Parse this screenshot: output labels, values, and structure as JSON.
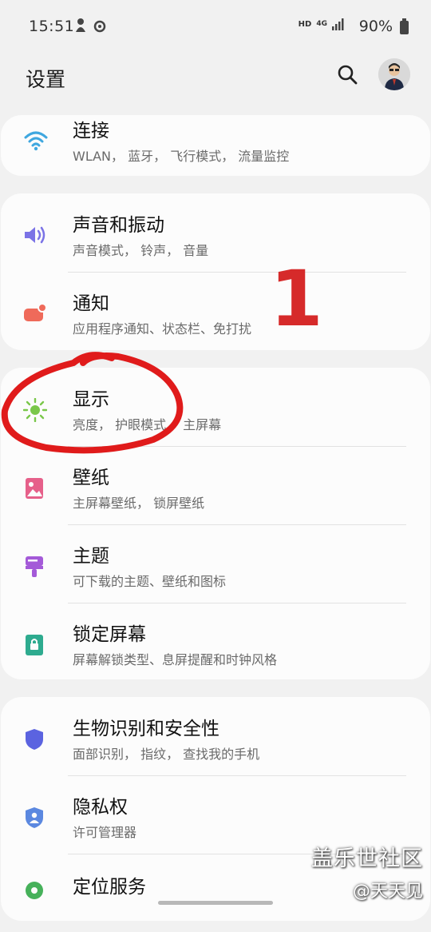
{
  "status_bar": {
    "time": "15:51",
    "hd": "HD",
    "network": "4G",
    "battery": "90%"
  },
  "header": {
    "title": "设置"
  },
  "sections": [
    {
      "items": [
        {
          "title": "连接",
          "subtitle": "WLAN， 蓝牙， 飞行模式， 流量监控",
          "icon": "wifi-icon",
          "color": "#3fa7df"
        }
      ]
    },
    {
      "items": [
        {
          "title": "声音和振动",
          "subtitle": "声音模式， 铃声， 音量",
          "icon": "volume-icon",
          "color": "#7b73e6"
        },
        {
          "title": "通知",
          "subtitle": "应用程序通知、状态栏、免打扰",
          "icon": "notification-icon",
          "color": "#ef6a5a"
        }
      ]
    },
    {
      "items": [
        {
          "title": "显示",
          "subtitle": "亮度， 护眼模式， 主屏幕",
          "icon": "brightness-icon",
          "color": "#7ac74a"
        },
        {
          "title": "壁纸",
          "subtitle": "主屏幕壁纸， 锁屏壁纸",
          "icon": "wallpaper-icon",
          "color": "#e6608a"
        },
        {
          "title": "主题",
          "subtitle": "可下载的主题、壁纸和图标",
          "icon": "theme-icon",
          "color": "#a45ad8"
        },
        {
          "title": "锁定屏幕",
          "subtitle": "屏幕解锁类型、息屏提醒和时钟风格",
          "icon": "lock-screen-icon",
          "color": "#2eab8f"
        }
      ]
    },
    {
      "items": [
        {
          "title": "生物识别和安全性",
          "subtitle": "面部识别， 指纹， 查找我的手机",
          "icon": "shield-icon",
          "color": "#5b63e0"
        },
        {
          "title": "隐私权",
          "subtitle": "许可管理器",
          "icon": "privacy-icon",
          "color": "#5b88e0"
        },
        {
          "title": "定位服务",
          "subtitle": "",
          "icon": "location-icon",
          "color": "#46b15a"
        }
      ]
    }
  ],
  "annotation": {
    "number": "1"
  },
  "watermark": {
    "line1": "盖乐世社区",
    "line2": "@天天见"
  }
}
